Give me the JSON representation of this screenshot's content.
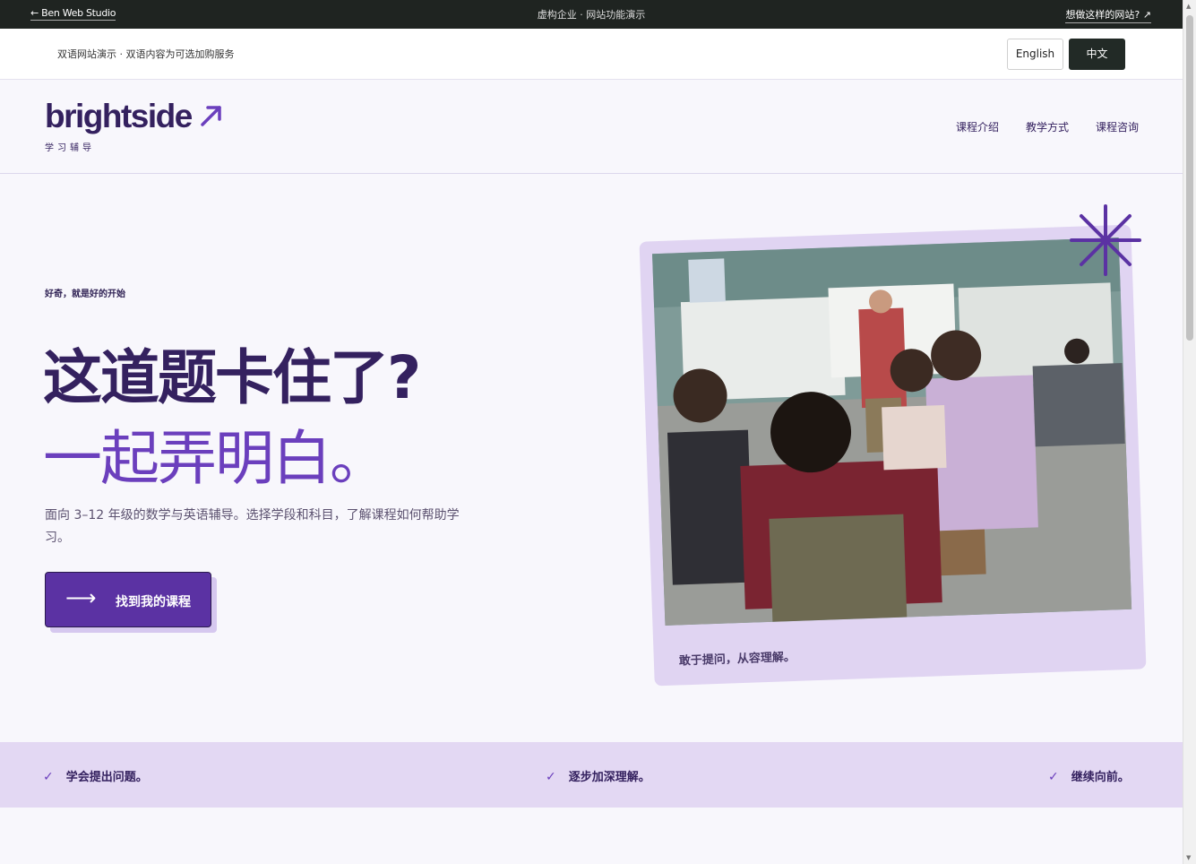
{
  "topbar": {
    "back_label": "← Ben Web Studio",
    "center_label": "虚构企业 · 网站功能演示",
    "want_label": "想做这样的网站? ↗"
  },
  "langbar": {
    "note": "双语网站演示 · 双语内容为可选加购服务",
    "english_label": "English",
    "chinese_label": "中文",
    "selected": "中文"
  },
  "header": {
    "logo": "brightside",
    "logo_sub": "学习辅导",
    "nav": [
      "课程介绍",
      "教学方式",
      "课程咨询"
    ]
  },
  "hero": {
    "eyebrow": "好奇，就是好的开始",
    "title_line1": "这道题卡住了?",
    "title_line2": "一起弄明白。",
    "description": "面向 3–12 年级的数学与英语辅导。选择学段和科目，了解课程如何帮助学习。",
    "cta_arrow": "⟶",
    "cta_label": "找到我的课程",
    "photo_caption": "敢于提问，从容理解。"
  },
  "ribbon": {
    "check": "✓",
    "items": [
      "学会提出问题。",
      "逐步加深理解。",
      "继续向前。"
    ]
  },
  "colors": {
    "brand_dark": "#34215f",
    "brand_purple": "#6b3fbd",
    "cta_bg": "#5b32a3",
    "lavender": "#e0d4f2",
    "topbar_bg": "#1f2421"
  }
}
